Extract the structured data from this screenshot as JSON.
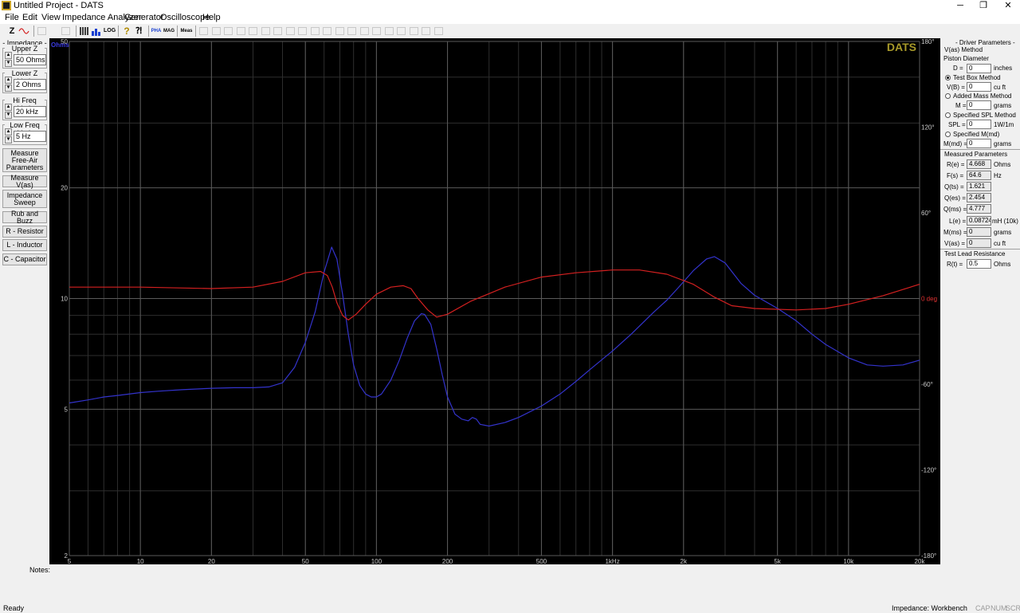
{
  "window": {
    "title": "Untitled Project - DATS",
    "minimize": "─",
    "maximize": "❐",
    "close": "✕"
  },
  "menu": [
    "File",
    "Edit",
    "View",
    "Impedance Analyzer",
    "Generator",
    "Oscilloscope",
    "Help"
  ],
  "toolbar": {
    "z_label": "Z",
    "pha_label": "PHA",
    "mag_label": "MAG",
    "log_label": "LOG",
    "meas_label": "Meas"
  },
  "left_panel": {
    "impedance_title": "- Impedance -",
    "upper_z": {
      "label": "Upper Z Limit",
      "value": "50 Ohms"
    },
    "lower_z": {
      "label": "Lower Z Limit",
      "value": "2 Ohms"
    },
    "hi_freq": {
      "label": "Hi Freq Limit",
      "value": "20 kHz"
    },
    "low_freq": {
      "label": "Low Freq Limit",
      "value": "5 Hz"
    },
    "buttons": [
      "Measure Free-Air Parameters",
      "Measure V(as)",
      "Impedance Sweep",
      "Rub and Buzz",
      "R - Resistor",
      "L - Inductor",
      "C - Capacitor"
    ]
  },
  "right_panel": {
    "title": "- Driver Parameters -",
    "vas_method": "V(as) Method",
    "piston_diameter": "Piston Diameter",
    "d": {
      "label": "D =",
      "value": "0",
      "unit": "inches"
    },
    "test_box": {
      "label": "Test Box Method",
      "selected": true
    },
    "vb": {
      "label": "V(B) =",
      "value": "0",
      "unit": "cu ft"
    },
    "added_mass": {
      "label": "Added Mass Method",
      "selected": false
    },
    "m": {
      "label": "M =",
      "value": "0",
      "unit": "grams"
    },
    "specified_spl": {
      "label": "Specified SPL Method",
      "selected": false
    },
    "spl": {
      "label": "SPL =",
      "value": "0",
      "unit": "1W/1m"
    },
    "specified_mmd": {
      "label": "Specified M(md)",
      "selected": false
    },
    "mmd": {
      "label": "M(md) =",
      "value": "0",
      "unit": "grams"
    },
    "measured_title": "Measured Parameters",
    "measured": [
      {
        "label": "R(e) =",
        "value": "4.668",
        "unit": "Ohms"
      },
      {
        "label": "F(s) =",
        "value": "64.6",
        "unit": "Hz"
      },
      {
        "label": "Q(ts) =",
        "value": "1.621",
        "unit": ""
      },
      {
        "label": "Q(es) =",
        "value": "2.454",
        "unit": ""
      },
      {
        "label": "Q(ms) =",
        "value": "4.777",
        "unit": ""
      },
      {
        "label": "L(e) =",
        "value": "0.08724",
        "unit": "mH (10k)"
      },
      {
        "label": "M(ms) =",
        "value": "0",
        "unit": "grams"
      },
      {
        "label": "V(as) =",
        "value": "0",
        "unit": "cu ft"
      }
    ],
    "lead_title": "Test Lead Resistance",
    "rt": {
      "label": "R(t) =",
      "value": "0.5",
      "unit": "Ohms"
    }
  },
  "notes_label": "Notes:",
  "status": {
    "ready": "Ready",
    "mode": "Impedance: Workbench",
    "cap": "CAP",
    "num": "NUM",
    "scrl": "SCRL"
  },
  "chart_data": {
    "type": "line",
    "watermark": "DATS",
    "y_left_unit": "Ohms",
    "y_right_unit": "0 deg",
    "x_scale": "log",
    "y_left_scale": "log",
    "xlim": [
      5,
      20000
    ],
    "ylim_left": [
      2,
      50
    ],
    "ylim_right": [
      -180,
      180
    ],
    "x_ticks": [
      {
        "v": 5,
        "t": "5"
      },
      {
        "v": 10,
        "t": "10"
      },
      {
        "v": 20,
        "t": "20"
      },
      {
        "v": 50,
        "t": "50"
      },
      {
        "v": 100,
        "t": "100"
      },
      {
        "v": 200,
        "t": "200"
      },
      {
        "v": 500,
        "t": "500"
      },
      {
        "v": 1000,
        "t": "1kHz"
      },
      {
        "v": 2000,
        "t": "2k"
      },
      {
        "v": 5000,
        "t": "5k"
      },
      {
        "v": 10000,
        "t": "10k"
      },
      {
        "v": 20000,
        "t": "20k"
      }
    ],
    "y_left_ticks": [
      {
        "v": 50,
        "t": "50"
      },
      {
        "v": 20,
        "t": "20"
      },
      {
        "v": 10,
        "t": "10"
      },
      {
        "v": 5,
        "t": "5"
      },
      {
        "v": 2,
        "t": "2"
      }
    ],
    "y_right_ticks": [
      {
        "v": 180,
        "t": "180°"
      },
      {
        "v": 120,
        "t": "120°"
      },
      {
        "v": 60,
        "t": "60°"
      },
      {
        "v": -60,
        "t": "-60°"
      },
      {
        "v": -120,
        "t": "-120°"
      },
      {
        "v": -180,
        "t": "-180°"
      }
    ],
    "grid": true,
    "colors": {
      "impedance": "#3333cc",
      "phase": "#d42020",
      "grid_major": "#5a5a5a",
      "grid_minor": "#2e2e2e",
      "axis_text": "#cccccc",
      "phase_text": "#e33333",
      "watermark": "#a89a2a",
      "unit_text": "#3a3ae0"
    },
    "series": [
      {
        "axis": "left",
        "points": [
          [
            5,
            5.2
          ],
          [
            6,
            5.3
          ],
          [
            7,
            5.4
          ],
          [
            8,
            5.45
          ],
          [
            10,
            5.55
          ],
          [
            12,
            5.6
          ],
          [
            15,
            5.65
          ],
          [
            20,
            5.7
          ],
          [
            25,
            5.72
          ],
          [
            30,
            5.72
          ],
          [
            35,
            5.75
          ],
          [
            40,
            5.9
          ],
          [
            45,
            6.5
          ],
          [
            50,
            7.6
          ],
          [
            55,
            9.2
          ],
          [
            60,
            11.8
          ],
          [
            64.6,
            13.8
          ],
          [
            68,
            12.8
          ],
          [
            72,
            10.2
          ],
          [
            76,
            8
          ],
          [
            80,
            6.6
          ],
          [
            85,
            5.8
          ],
          [
            90,
            5.5
          ],
          [
            95,
            5.4
          ],
          [
            100,
            5.4
          ],
          [
            105,
            5.5
          ],
          [
            115,
            6
          ],
          [
            125,
            6.8
          ],
          [
            135,
            7.8
          ],
          [
            145,
            8.7
          ],
          [
            155,
            9.1
          ],
          [
            160,
            9.05
          ],
          [
            170,
            8.5
          ],
          [
            180,
            7.3
          ],
          [
            190,
            6.2
          ],
          [
            200,
            5.4
          ],
          [
            215,
            4.85
          ],
          [
            230,
            4.7
          ],
          [
            245,
            4.65
          ],
          [
            255,
            4.75
          ],
          [
            265,
            4.7
          ],
          [
            275,
            4.55
          ],
          [
            300,
            4.5
          ],
          [
            350,
            4.6
          ],
          [
            400,
            4.75
          ],
          [
            500,
            5.1
          ],
          [
            600,
            5.5
          ],
          [
            700,
            5.95
          ],
          [
            800,
            6.4
          ],
          [
            1000,
            7.2
          ],
          [
            1200,
            8
          ],
          [
            1500,
            9.2
          ],
          [
            1700,
            9.9
          ],
          [
            1900,
            10.7
          ],
          [
            2200,
            11.9
          ],
          [
            2500,
            12.8
          ],
          [
            2700,
            13
          ],
          [
            3000,
            12.5
          ],
          [
            3500,
            11
          ],
          [
            4000,
            10.2
          ],
          [
            5000,
            9.4
          ],
          [
            6000,
            8.7
          ],
          [
            7000,
            8
          ],
          [
            8000,
            7.5
          ],
          [
            10000,
            6.9
          ],
          [
            12000,
            6.6
          ],
          [
            14000,
            6.55
          ],
          [
            17000,
            6.6
          ],
          [
            20000,
            6.8
          ]
        ]
      },
      {
        "axis": "right",
        "points": [
          [
            5,
            8
          ],
          [
            10,
            8
          ],
          [
            20,
            7
          ],
          [
            30,
            8
          ],
          [
            40,
            12
          ],
          [
            50,
            18
          ],
          [
            58,
            19
          ],
          [
            62,
            16
          ],
          [
            65,
            8
          ],
          [
            68,
            -3
          ],
          [
            72,
            -12
          ],
          [
            76,
            -15
          ],
          [
            82,
            -11
          ],
          [
            90,
            -4
          ],
          [
            100,
            3
          ],
          [
            115,
            8
          ],
          [
            130,
            9
          ],
          [
            140,
            7
          ],
          [
            150,
            0
          ],
          [
            165,
            -8
          ],
          [
            180,
            -13
          ],
          [
            200,
            -11
          ],
          [
            250,
            -2
          ],
          [
            350,
            8
          ],
          [
            500,
            15
          ],
          [
            700,
            18
          ],
          [
            1000,
            20
          ],
          [
            1300,
            20
          ],
          [
            1700,
            17
          ],
          [
            2200,
            10
          ],
          [
            2700,
            1
          ],
          [
            3200,
            -5
          ],
          [
            4000,
            -7
          ],
          [
            6000,
            -8
          ],
          [
            8000,
            -7
          ],
          [
            10000,
            -4
          ],
          [
            14000,
            2
          ],
          [
            20000,
            10
          ]
        ]
      }
    ]
  }
}
